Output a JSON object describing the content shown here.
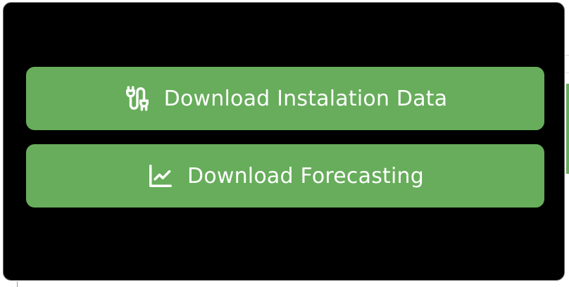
{
  "dialog": {
    "buttons": [
      {
        "label": "Download Instalation Data",
        "icon": "plug-cable-icon"
      },
      {
        "label": "Download Forecasting",
        "icon": "line-chart-icon"
      }
    ]
  },
  "colors": {
    "button_bg": "#67ad5b",
    "button_text": "#ffffff",
    "dialog_bg": "#000000",
    "dialog_border": "#6a6a6a"
  }
}
